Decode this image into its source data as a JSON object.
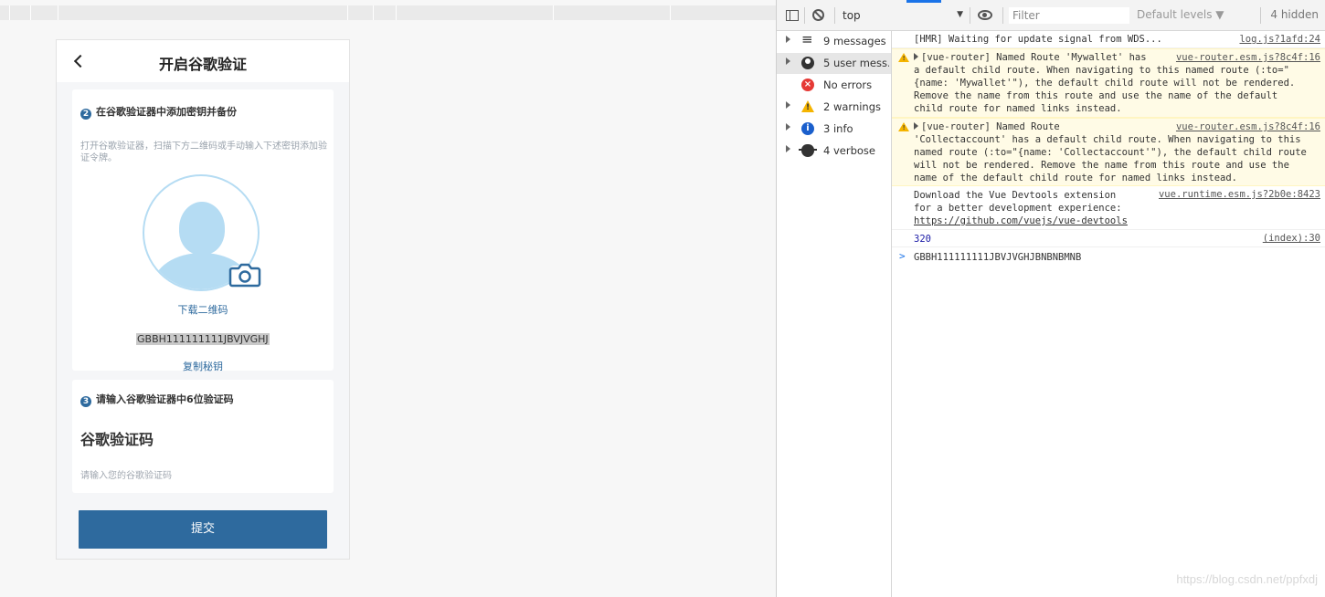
{
  "page": {
    "title": "开启谷歌验证",
    "step2": {
      "number": "2",
      "title": "在谷歌验证器中添加密钥并备份",
      "instructions": "打开谷歌验证器，扫描下方二维码或手动输入下述密钥添加验证令牌。",
      "download_label": "下载二维码",
      "secret_key": "GBBH111111111JBVJVGHJ",
      "copy_label": "复制秘钥"
    },
    "step3": {
      "number": "3",
      "title": "请输入谷歌验证器中6位验证码",
      "code_label": "谷歌验证码",
      "code_placeholder": "请输入您的谷歌验证码",
      "code_value": ""
    },
    "submit_label": "提交"
  },
  "devtools": {
    "toolbar": {
      "context": "top",
      "context_arrow": "▼",
      "filter_placeholder": "Filter",
      "levels": "Default levels ▼",
      "hidden": "4 hidden"
    },
    "sidebar": [
      {
        "icon": "list-icon",
        "label": "9 messages",
        "selected": false
      },
      {
        "icon": "user-icon",
        "label": "5 user mess...",
        "selected": true
      },
      {
        "icon": "error-icon",
        "label": "No errors",
        "selected": false
      },
      {
        "icon": "warning-icon",
        "label": "2 warnings",
        "selected": false
      },
      {
        "icon": "info-icon",
        "label": "3 info",
        "selected": false
      },
      {
        "icon": "bug-icon",
        "label": "4 verbose",
        "selected": false
      }
    ],
    "logs": {
      "hmr": {
        "text": "[HMR] Waiting for update signal from WDS...",
        "source": "log.js?1afd:24"
      },
      "warn1": {
        "lines": [
          "[vue-router] Named Route 'Mywallet' has",
          "a default child route. When navigating to this named route (:to=\"",
          "{name: 'Mywallet'\"), the default child route will not be rendered.",
          "Remove the name from this route and use the name of the default",
          "child route for named links instead."
        ],
        "source": "vue-router.esm.js?8c4f:16"
      },
      "warn2": {
        "lines": [
          "[vue-router] Named Route",
          "'Collectaccount' has a default child route. When navigating to this",
          "named route (:to=\"{name: 'Collectaccount'\"), the default child route",
          "will not be rendered. Remove the name from this route and use the",
          "name of the default child route for named links instead."
        ],
        "source": "vue-router.esm.js?8c4f:16"
      },
      "devtools_msg": {
        "lines": [
          "Download the Vue Devtools extension",
          "for a better development experience:"
        ],
        "link": "https://github.com/vuejs/vue-devtools",
        "source": "vue.runtime.esm.js?2b0e:8423"
      },
      "number": {
        "value": "320",
        "source": "(index):30"
      },
      "prompt": {
        "arrow": ">",
        "text": "GBBH111111111JBVJVGHJBNBNBMNB"
      }
    }
  },
  "watermark": "https://blog.csdn.net/ppfxdj",
  "colors": {
    "accent": "#2e6a9e",
    "avatar": "#b5dcf3",
    "warn_bg": "#fffbe6"
  }
}
